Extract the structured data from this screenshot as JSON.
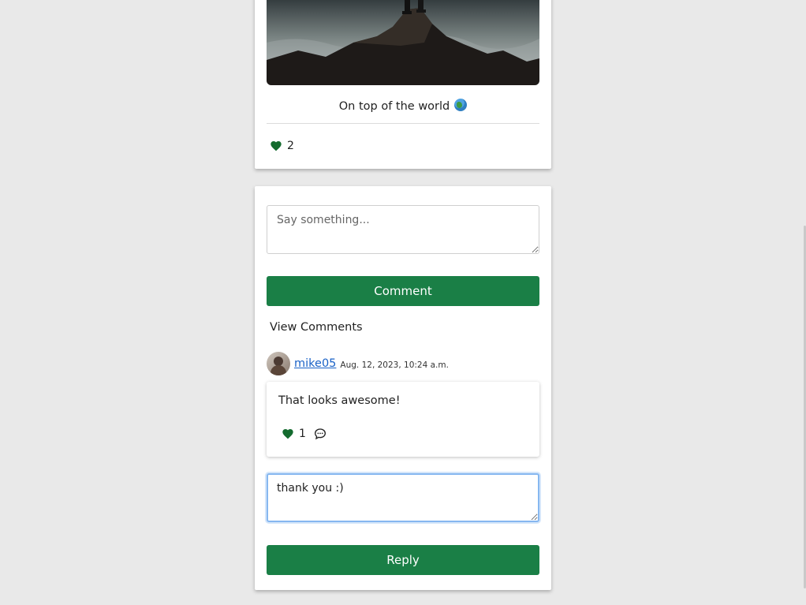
{
  "post": {
    "caption": "On top of the world",
    "like_count": "2",
    "colors": {
      "accent": "#1a7f46",
      "heart": "#146b2e"
    }
  },
  "comment_form": {
    "placeholder": "Say something...",
    "submit_label": "Comment"
  },
  "comments_section": {
    "view_label": "View Comments",
    "comments": [
      {
        "username": "mike05",
        "timestamp": "Aug. 12, 2023, 10:24 a.m.",
        "text": "That looks awesome!",
        "like_count": "1",
        "reply_value": "thank you :)",
        "reply_label": "Reply"
      }
    ]
  },
  "icons": [
    "heart-icon",
    "globe-icon",
    "speech-bubble-icon",
    "avatar"
  ]
}
